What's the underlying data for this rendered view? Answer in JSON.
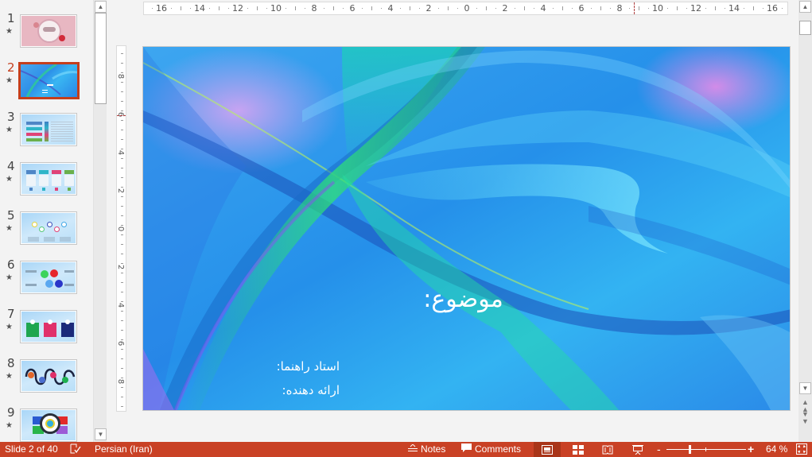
{
  "app": {
    "accent_color": "#c94125",
    "active_thumb_color": "#c43e1c"
  },
  "thumbnails": [
    {
      "number": "1",
      "icon": "star-icon",
      "theme": "floral-pink",
      "active": false
    },
    {
      "number": "2",
      "icon": "star-icon",
      "theme": "blue-waves",
      "active": true
    },
    {
      "number": "3",
      "icon": "star-icon",
      "theme": "list-buttons",
      "active": false
    },
    {
      "number": "4",
      "icon": "star-icon",
      "theme": "four-columns",
      "active": false
    },
    {
      "number": "5",
      "icon": "star-icon",
      "theme": "hexagons",
      "active": false
    },
    {
      "number": "6",
      "icon": "star-icon",
      "theme": "color-hexes",
      "active": false
    },
    {
      "number": "7",
      "icon": "star-icon",
      "theme": "three-cards",
      "active": false
    },
    {
      "number": "8",
      "icon": "star-icon",
      "theme": "wave-circles",
      "active": false
    },
    {
      "number": "9",
      "icon": "star-icon",
      "theme": "target-grid",
      "active": false
    }
  ],
  "ruler": {
    "horizontal_labels": [
      "16",
      "14",
      "12",
      "10",
      "8",
      "6",
      "4",
      "2",
      "0",
      "2",
      "4",
      "6",
      "8",
      "10",
      "12",
      "14",
      "16"
    ],
    "vertical_labels": [
      "8",
      "6",
      "4",
      "2",
      "0",
      "2",
      "4",
      "6",
      "8"
    ]
  },
  "slide": {
    "title": "موضوع:",
    "line1": "استاد راهنما:",
    "line2": "ارائه دهنده:"
  },
  "statusbar": {
    "slide_info": "Slide 2 of 40",
    "spellcheck_icon": "proofing-icon",
    "language": "Persian (Iran)",
    "notes_label": "Notes",
    "comments_label": "Comments",
    "zoom_minus": "-",
    "zoom_plus": "+",
    "zoom_level": "64 %",
    "zoom_fraction": 0.64,
    "active_view": "normal"
  }
}
